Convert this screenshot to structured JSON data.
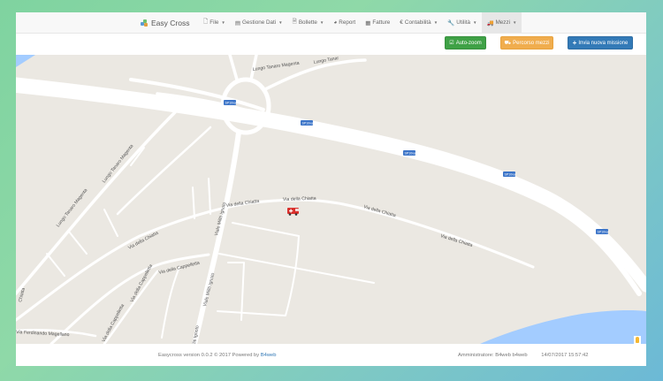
{
  "app": {
    "title": "Easy Cross"
  },
  "nav": {
    "items": [
      {
        "label": "File",
        "icon": "file-icon",
        "has_caret": true
      },
      {
        "label": "Gestione Dati",
        "icon": "database-icon",
        "has_caret": true
      },
      {
        "label": "Bollette",
        "icon": "document-icon",
        "has_caret": true
      },
      {
        "label": "Report",
        "icon": "pie-chart-icon",
        "has_caret": false
      },
      {
        "label": "Fatture",
        "icon": "invoice-icon",
        "has_caret": false
      },
      {
        "label": "Contabilità",
        "icon": "euro-icon",
        "has_caret": true
      },
      {
        "label": "Utilità",
        "icon": "wrench-icon",
        "has_caret": true
      },
      {
        "label": "Mezzi",
        "icon": "truck-icon",
        "has_caret": true,
        "active": true
      }
    ]
  },
  "toolbar": {
    "autozoom_label": "Auto-zoom",
    "percorso_label": "Percorso mezzi",
    "invia_label": "Invia nuova missione"
  },
  "map": {
    "labels": {
      "lungo_tanaro_magenta_top": "Lungo Tanaro Magenta",
      "lungo_tanaro_short": "Lungo Tanar",
      "lungo_tanaro_magenta_left": "Lungo Tanaro Magenta",
      "lungo_tanaro_magenta_left2": "Lungo Tanaro Magenta",
      "via_della_chiatta_1": "Via della Chiatta",
      "via_della_chiatta_2": "Via della Chiatta",
      "via_della_chiatta_3": "Via della Chiatta",
      "via_della_chiatta_4": "Via della Chiatta",
      "via_della_chiatta_5": "Via della Chiatta",
      "via_della_cappelletta_1": "Via della Cappelletta",
      "via_della_cappelletta_2": "Via della Cappelletta",
      "via_della_cappelletta_3": "Via della Cappelletta",
      "viale_militi_ignoto_1": "Viale Militi Ignoto",
      "viale_militi_ignoto_2": "Viale Militi Ignoto",
      "viale_militi_ignoto_3": "Viale Militi Ignoto",
      "via_ferdinando": "Via Ferdinando Magellano",
      "chiatta_left": "Chiatta"
    },
    "road_shield": "SP10var",
    "vehicle_icon": "ambulance-icon",
    "colors": {
      "land": "#ebe8e2",
      "road": "#ffffff",
      "water": "#a3ccff",
      "shield": "#3b74c8",
      "vehicle": "#d9302c"
    }
  },
  "footer": {
    "version_text": "Easycross version 0.0.2 © 2017 Powered by",
    "powered_link": "B4web",
    "user_text": "Amministratore: B4web b4web",
    "timestamp": "14/07/2017 15:57:42"
  },
  "colors": {
    "btn_green": "#3fa146",
    "btn_orange": "#f0ad4e",
    "btn_blue": "#337ab7"
  }
}
